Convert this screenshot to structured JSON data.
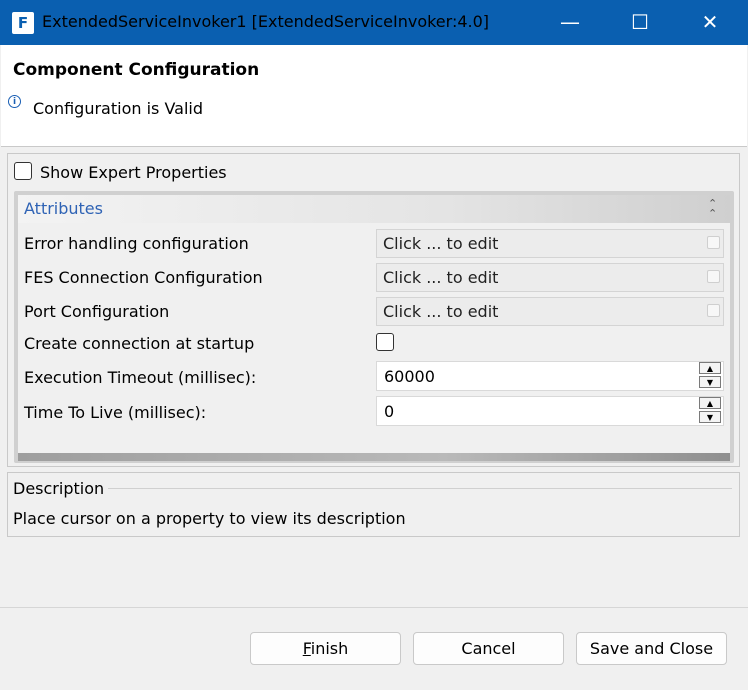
{
  "window": {
    "title": "ExtendedServiceInvoker1 [ExtendedServiceInvoker:4.0]",
    "app_icon": "app-logo-icon",
    "controls": [
      "minimize-icon",
      "maximize-icon",
      "close-icon"
    ]
  },
  "header": {
    "title": "Component Configuration",
    "status": "Configuration is Valid",
    "status_icon": "info-icon"
  },
  "options": {
    "show_expert_label": "Show Expert Properties",
    "show_expert_checked": false
  },
  "attributes": {
    "section_title": "Attributes",
    "collapse_icon": "collapse-up-icon",
    "rows": [
      {
        "label": "Error handling configuration",
        "type": "editor",
        "value": "Click ... to edit"
      },
      {
        "label": "FES Connection Configuration",
        "type": "editor",
        "value": "Click ... to edit"
      },
      {
        "label": "Port Configuration",
        "type": "editor",
        "value": "Click ... to edit"
      },
      {
        "label": "Create connection at startup",
        "type": "checkbox",
        "checked": false
      },
      {
        "label": "Execution Timeout (millisec):",
        "type": "spinner",
        "value": "60000"
      },
      {
        "label": "Time To Live (millisec):",
        "type": "spinner",
        "value": "0"
      }
    ]
  },
  "description": {
    "title": "Description",
    "text": "Place cursor on a property to view its description"
  },
  "buttons": {
    "finish_prefix": "F",
    "finish_rest": "inish",
    "cancel": "Cancel",
    "save_close": "Save and Close"
  },
  "colors": {
    "titlebar": "#0a5fb0",
    "section_title": "#2f63b5"
  }
}
